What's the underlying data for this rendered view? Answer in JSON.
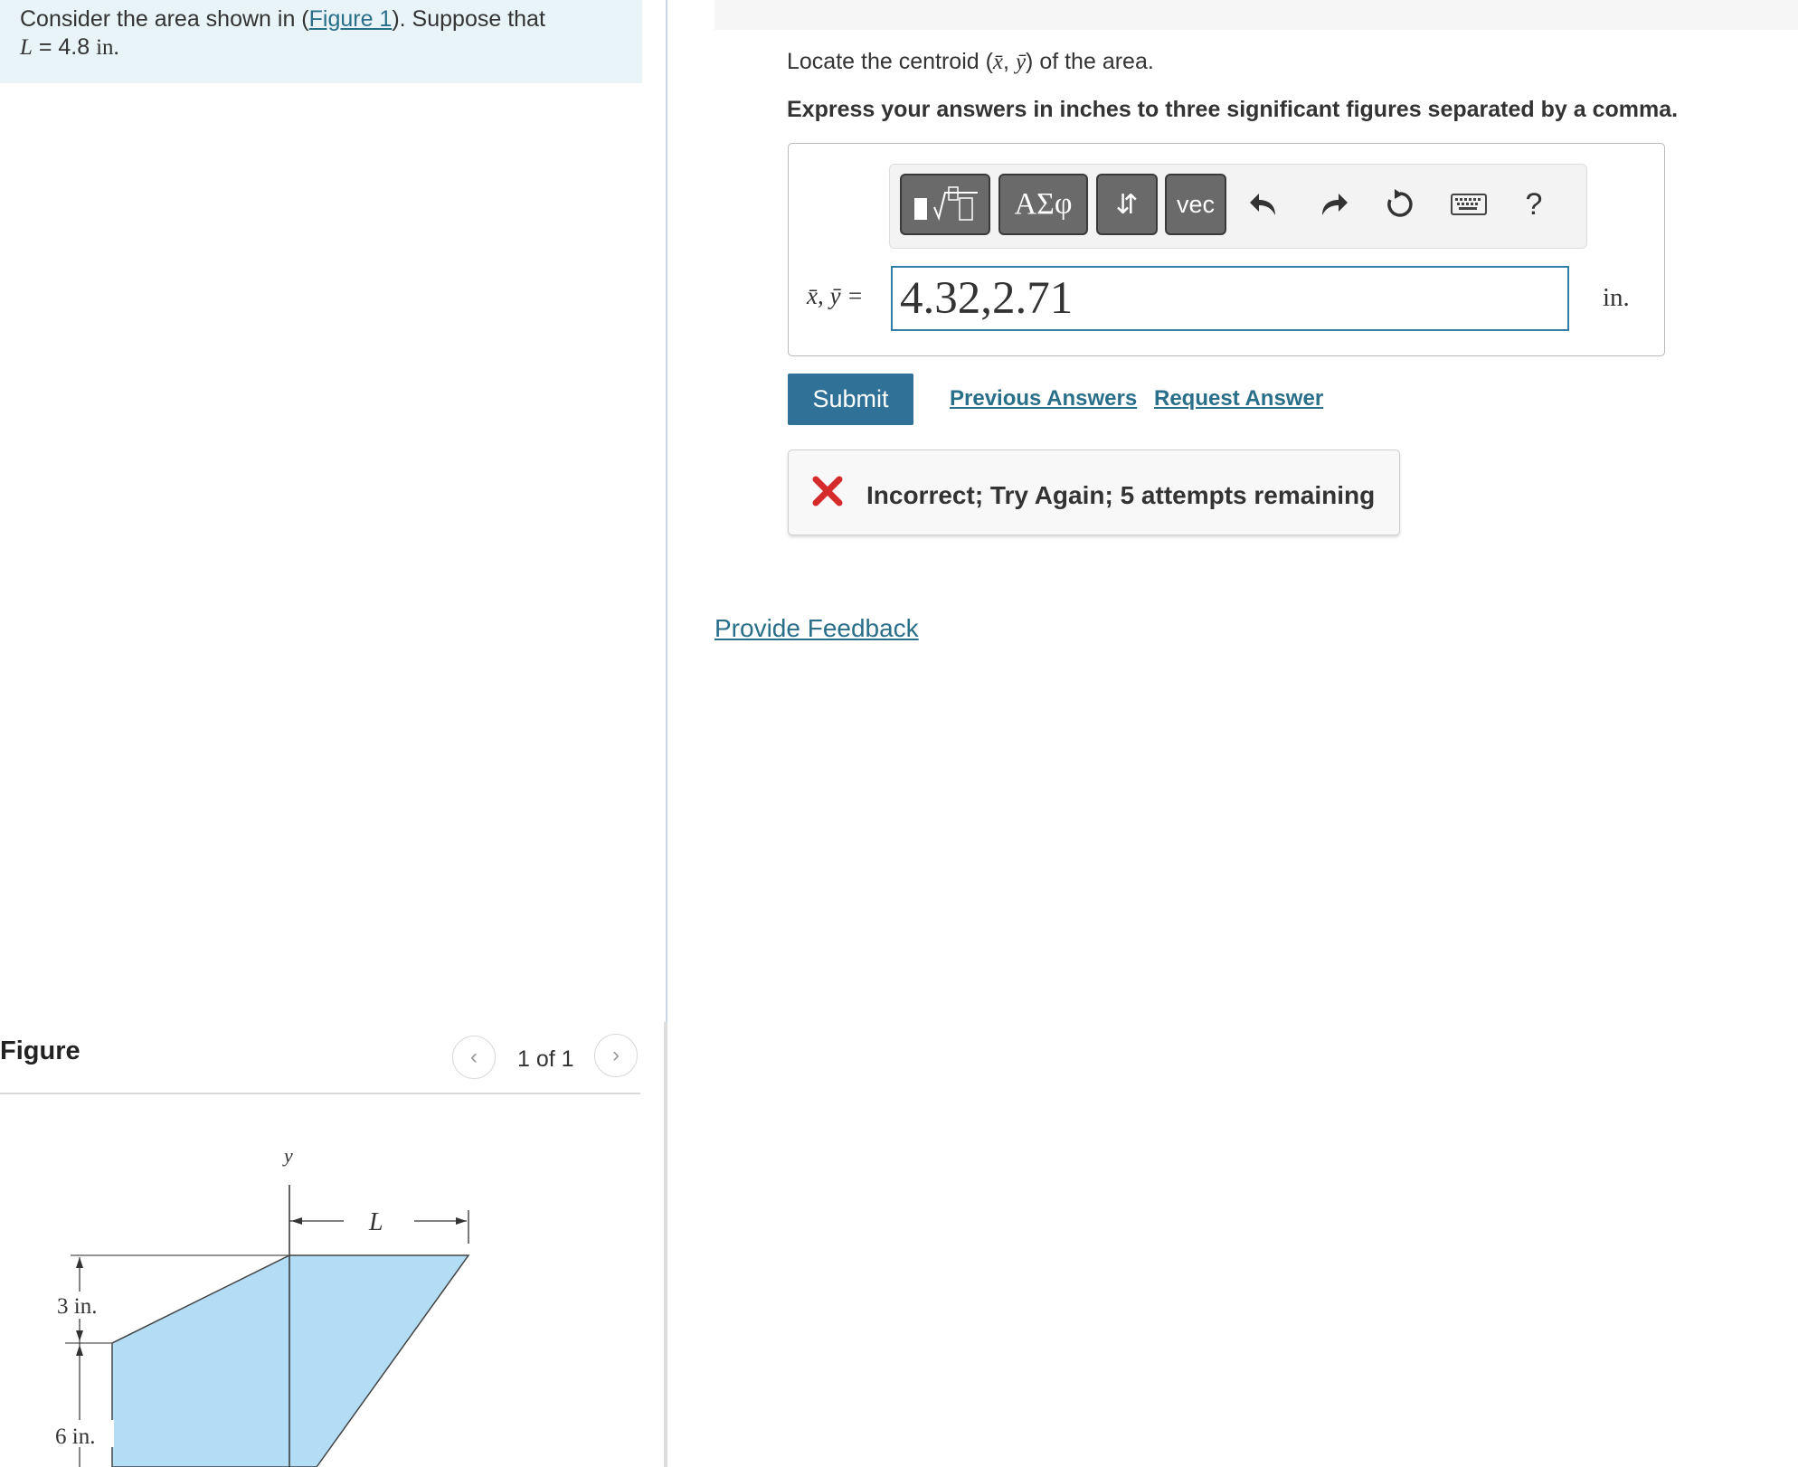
{
  "problem": {
    "intro": "Consider the area shown in (",
    "figure_link": "Figure 1",
    "intro_end": "). Suppose that",
    "var": "L",
    "equals": " = 4.8 ",
    "unit": "in."
  },
  "figure_panel": {
    "title": "Figure",
    "count": "1 of 1",
    "labels": {
      "y_axis": "y",
      "L": "L",
      "dim_top": "3 in.",
      "dim_mid": "6 in."
    },
    "fill_color": "#b3dcf5"
  },
  "question": {
    "prefix": "Locate the centroid (",
    "xbar": "x̄",
    "sep": ", ",
    "ybar": "ȳ",
    "suffix": ") of the area."
  },
  "instruction": "Express your answers in inches to three significant figures separated by a comma.",
  "toolbar": {
    "greek": "ΑΣφ",
    "arrows": "⇵",
    "vec": "vec",
    "help": "?"
  },
  "answer": {
    "label": "x̄, ȳ =",
    "value": "4.32,2.71",
    "unit": "in."
  },
  "actions": {
    "submit": "Submit",
    "previous_answers": "Previous Answers",
    "request_answer": "Request Answer"
  },
  "feedback": {
    "message": "Incorrect; Try Again; 5 attempts remaining",
    "icon_color": "#d62b2b"
  },
  "provide_feedback": "Provide Feedback"
}
